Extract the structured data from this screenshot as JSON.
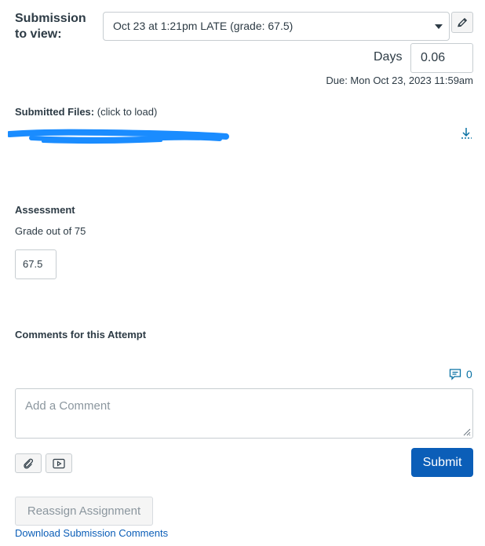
{
  "submission": {
    "label": "Submission to view:",
    "selected": "Oct 23 at 1:21pm LATE (grade: 67.5)"
  },
  "days": {
    "label": "Days",
    "value": "0.06"
  },
  "due": "Due: Mon Oct 23, 2023 11:59am",
  "files": {
    "label": "Submitted Files:",
    "hint": "(click to load)"
  },
  "assessment": {
    "heading": "Assessment",
    "grade_out_of": "Grade out of 75",
    "grade_value": "67.5"
  },
  "comments": {
    "heading": "Comments for this Attempt",
    "count": "0",
    "placeholder": "Add a Comment",
    "submit_label": "Submit"
  },
  "actions": {
    "reassign_label": "Reassign Assignment",
    "download_comments_label": "Download Submission Comments"
  },
  "icons": {
    "edit": "pencil-icon",
    "download": "download-icon",
    "comment_count": "comment-bubble-icon",
    "attach": "paperclip-icon",
    "media": "media-icon"
  },
  "colors": {
    "accent": "#0b5eb8",
    "link": "#0770a3",
    "redaction": "#1a8cff"
  }
}
